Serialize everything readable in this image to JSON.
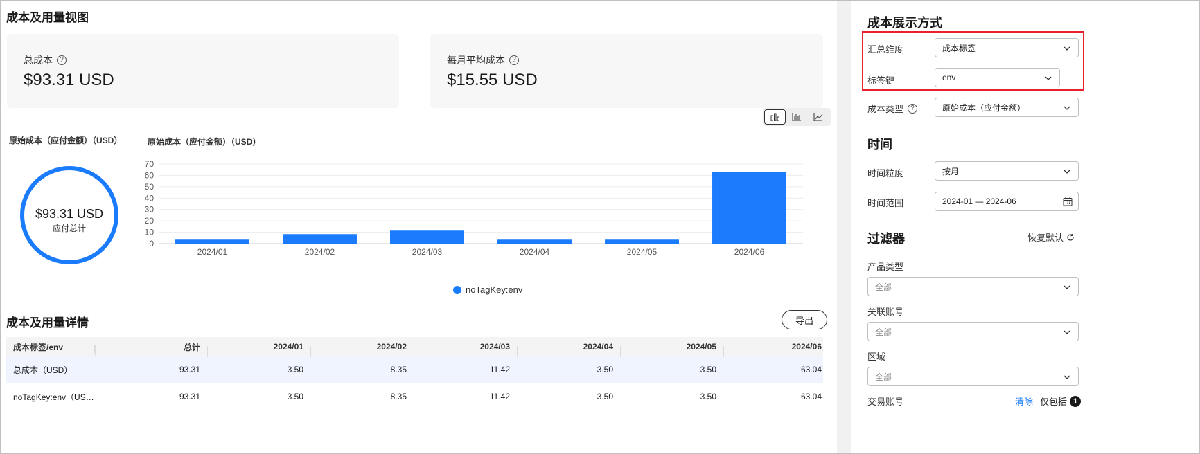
{
  "main": {
    "title": "成本及用量视图",
    "cards": [
      {
        "label": "总成本",
        "value": "$93.31 USD"
      },
      {
        "label": "每月平均成本",
        "value": "$15.55 USD"
      }
    ],
    "donut": {
      "title": "原始成本（应付金额）（USD）",
      "value": "$93.31 USD",
      "subtitle": "应付总计"
    },
    "details_title": "成本及用量详情",
    "export_label": "导出",
    "table": {
      "headers": [
        "成本标签/env",
        "总计",
        "2024/01",
        "2024/02",
        "2024/03",
        "2024/04",
        "2024/05",
        "2024/06"
      ],
      "rows": [
        [
          "总成本（USD）",
          "93.31",
          "3.50",
          "8.35",
          "11.42",
          "3.50",
          "3.50",
          "63.04"
        ],
        [
          "noTagKey:env（USD）",
          "93.31",
          "3.50",
          "8.35",
          "11.42",
          "3.50",
          "3.50",
          "63.04"
        ]
      ]
    }
  },
  "chart_data": {
    "type": "bar",
    "title": "原始成本（应付金额）（USD）",
    "categories": [
      "2024/01",
      "2024/02",
      "2024/03",
      "2024/04",
      "2024/05",
      "2024/06"
    ],
    "series": [
      {
        "name": "noTagKey:env",
        "values": [
          3.5,
          8.35,
          11.42,
          3.5,
          3.5,
          63.04
        ]
      }
    ],
    "ylim": [
      0,
      70
    ],
    "yticks": [
      0,
      10,
      20,
      30,
      40,
      50,
      60,
      70
    ],
    "grid": true,
    "legend": "bottom-center",
    "color": "#1a7cfd"
  },
  "panel": {
    "display_title": "成本展示方式",
    "summary_dim_label": "汇总维度",
    "summary_dim_value": "成本标签",
    "tag_key_label": "标签键",
    "tag_key_value": "env",
    "cost_type_label": "成本类型",
    "cost_type_value": "原始成本（应付金额）",
    "time_title": "时间",
    "granularity_label": "时间粒度",
    "granularity_value": "按月",
    "range_label": "时间范围",
    "range_value": "2024-01 — 2024-06",
    "filter_title": "过滤器",
    "restore_label": "恢复默认",
    "product_label": "产品类型",
    "product_value": "全部",
    "account_label": "关联账号",
    "account_value": "全部",
    "region_label": "区域",
    "region_value": "全部",
    "trade_label": "交易账号",
    "clear_label": "清除",
    "only_incl_label": "仅包括",
    "only_incl_count": "1"
  },
  "colors": {
    "accent": "#1a7cfd",
    "highlight": "#e8212f"
  }
}
